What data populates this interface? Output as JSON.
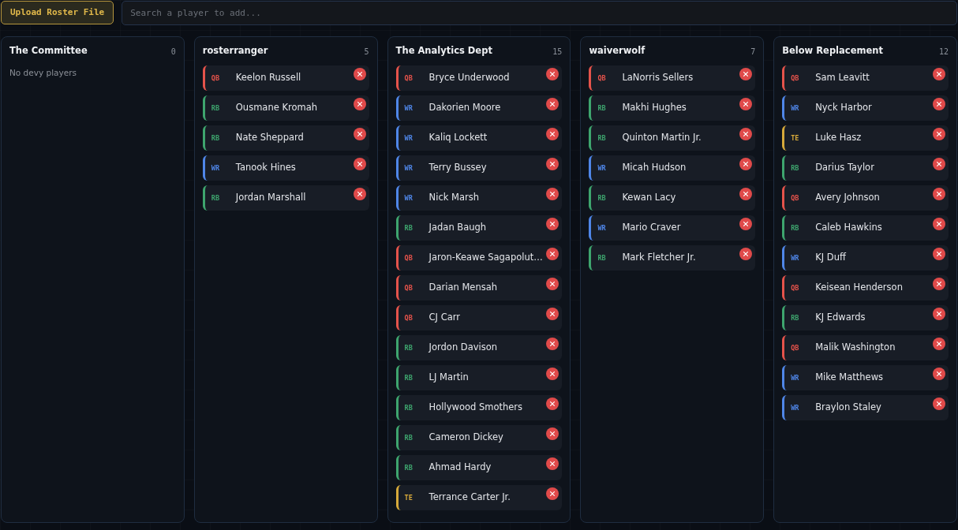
{
  "toolbar": {
    "upload_button": "Upload Roster File",
    "search": {
      "placeholder": "Search a player to add..."
    }
  },
  "teams": [
    {
      "name": "The Committee",
      "count": "0",
      "empty_message": "No devy players"
    },
    {
      "name": "rosterranger",
      "count": "5",
      "players": [
        {
          "position": "QB",
          "name": "Keelon Russell",
          "color": "#e5534b"
        },
        {
          "position": "RB",
          "name": "Ousmane Kromah",
          "color": "#3ea56e"
        },
        {
          "position": "RB",
          "name": "Nate Sheppard",
          "color": "#3ea56e"
        },
        {
          "position": "WR",
          "name": "Tanook Hines",
          "color": "#4f86e8"
        },
        {
          "position": "RB",
          "name": "Jordan Marshall",
          "color": "#3ea56e"
        }
      ]
    },
    {
      "name": "The Analytics Dept",
      "count": "15",
      "players": [
        {
          "position": "QB",
          "name": "Bryce Underwood",
          "color": "#e5534b"
        },
        {
          "position": "WR",
          "name": "Dakorien Moore",
          "color": "#4f86e8"
        },
        {
          "position": "WR",
          "name": "Kaliq Lockett",
          "color": "#4f86e8"
        },
        {
          "position": "WR",
          "name": "Terry Bussey",
          "color": "#4f86e8"
        },
        {
          "position": "WR",
          "name": "Nick Marsh",
          "color": "#4f86e8"
        },
        {
          "position": "RB",
          "name": "Jadan Baugh",
          "color": "#3ea56e"
        },
        {
          "position": "QB",
          "name": "Jaron-Keawe Sagapolut…",
          "color": "#e5534b"
        },
        {
          "position": "QB",
          "name": "Darian Mensah",
          "color": "#e5534b"
        },
        {
          "position": "QB",
          "name": "CJ Carr",
          "color": "#e5534b"
        },
        {
          "position": "RB",
          "name": "Jordon Davison",
          "color": "#3ea56e"
        },
        {
          "position": "RB",
          "name": "LJ Martin",
          "color": "#3ea56e"
        },
        {
          "position": "RB",
          "name": "Hollywood Smothers",
          "color": "#3ea56e"
        },
        {
          "position": "RB",
          "name": "Cameron Dickey",
          "color": "#3ea56e"
        },
        {
          "position": "RB",
          "name": "Ahmad Hardy",
          "color": "#3ea56e"
        },
        {
          "position": "TE",
          "name": "Terrance Carter Jr.",
          "color": "#d6a93a"
        }
      ]
    },
    {
      "name": "waiverwolf",
      "count": "7",
      "players": [
        {
          "position": "QB",
          "name": "LaNorris Sellers",
          "color": "#e5534b"
        },
        {
          "position": "RB",
          "name": "Makhi Hughes",
          "color": "#3ea56e"
        },
        {
          "position": "RB",
          "name": "Quinton Martin Jr.",
          "color": "#3ea56e"
        },
        {
          "position": "WR",
          "name": "Micah Hudson",
          "color": "#4f86e8"
        },
        {
          "position": "RB",
          "name": "Kewan Lacy",
          "color": "#3ea56e"
        },
        {
          "position": "WR",
          "name": "Mario Craver",
          "color": "#4f86e8"
        },
        {
          "position": "RB",
          "name": "Mark Fletcher Jr.",
          "color": "#3ea56e"
        }
      ]
    },
    {
      "name": "Below Replacement",
      "count": "12",
      "players": [
        {
          "position": "QB",
          "name": "Sam Leavitt",
          "color": "#e5534b"
        },
        {
          "position": "WR",
          "name": "Nyck Harbor",
          "color": "#4f86e8"
        },
        {
          "position": "TE",
          "name": "Luke Hasz",
          "color": "#d6a93a"
        },
        {
          "position": "RB",
          "name": "Darius Taylor",
          "color": "#3ea56e"
        },
        {
          "position": "QB",
          "name": "Avery Johnson",
          "color": "#e5534b"
        },
        {
          "position": "RB",
          "name": "Caleb Hawkins",
          "color": "#3ea56e"
        },
        {
          "position": "WR",
          "name": "KJ Duff",
          "color": "#4f86e8"
        },
        {
          "position": "QB",
          "name": "Keisean Henderson",
          "color": "#e5534b"
        },
        {
          "position": "RB",
          "name": "KJ Edwards",
          "color": "#3ea56e"
        },
        {
          "position": "QB",
          "name": "Malik Washington",
          "color": "#e5534b"
        },
        {
          "position": "WR",
          "name": "Mike Matthews",
          "color": "#4f86e8"
        },
        {
          "position": "WR",
          "name": "Braylon Staley",
          "color": "#4f86e8"
        }
      ]
    }
  ]
}
